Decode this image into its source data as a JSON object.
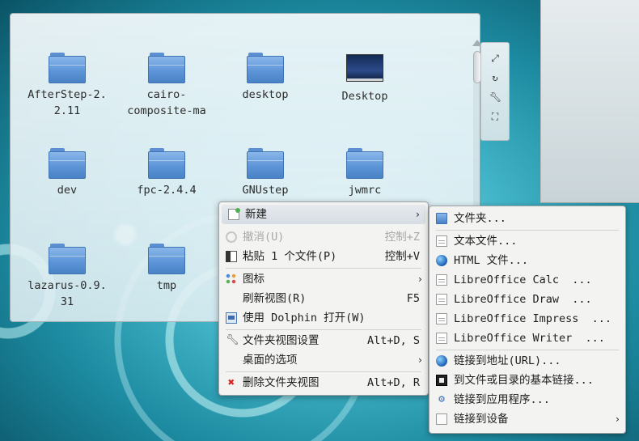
{
  "desktop_icons": [
    {
      "label": "AfterStep-2.\n2.11",
      "kind": "folder"
    },
    {
      "label": "cairo-\ncomposite-ma",
      "kind": "folder"
    },
    {
      "label": "desktop",
      "kind": "folder"
    },
    {
      "label": "Desktop",
      "kind": "screen"
    },
    {
      "label": "dev",
      "kind": "folder"
    },
    {
      "label": "fpc-2.4.4",
      "kind": "folder"
    },
    {
      "label": "GNUstep",
      "kind": "folder"
    },
    {
      "label": "jwmrc",
      "kind": "folder"
    },
    {
      "label": "lazarus-0.9.\n31",
      "kind": "folder"
    },
    {
      "label": "tmp",
      "kind": "folder"
    }
  ],
  "toolbox_icons": [
    "resize-icon",
    "rotate-icon",
    "settings-wrench-icon",
    "maximize-icon"
  ],
  "context_menu": {
    "items": [
      {
        "label": "新建",
        "icon": "new-icon",
        "submenu": true,
        "highlighted": true
      },
      {
        "label": "撤消(U)",
        "shortcut": "控制+Z",
        "icon": "undo-icon",
        "disabled": true
      },
      {
        "label": "粘贴 1 个文件(P)",
        "shortcut": "控制+V",
        "icon": "paste-icon"
      },
      {
        "label": "图标",
        "icon": "icons-grid-icon",
        "submenu": true
      },
      {
        "label": "刷新视图(R)",
        "shortcut": "F5"
      },
      {
        "label": "使用 Dolphin 打开(W)",
        "icon": "dolphin-icon"
      },
      {
        "label": "文件夹视图设置",
        "shortcut": "Alt+D, S",
        "icon": "wrench-icon"
      },
      {
        "label": "桌面的选项",
        "submenu": true
      },
      {
        "label": "删除文件夹视图",
        "shortcut": "Alt+D, R",
        "icon": "delete-icon"
      }
    ]
  },
  "new_submenu": {
    "items": [
      {
        "label": "文件夹...",
        "icon": "folder-icon"
      },
      {
        "label": "文本文件...",
        "icon": "text-file-icon"
      },
      {
        "label": "HTML 文件...",
        "icon": "html-globe-icon"
      },
      {
        "label": "LibreOffice Calc  ...",
        "icon": "calc-doc-icon"
      },
      {
        "label": "LibreOffice Draw  ...",
        "icon": "draw-doc-icon"
      },
      {
        "label": "LibreOffice Impress  ...",
        "icon": "impress-doc-icon"
      },
      {
        "label": "LibreOffice Writer  ...",
        "icon": "writer-doc-icon"
      },
      {
        "label": "链接到地址(URL)...",
        "icon": "url-globe-icon"
      },
      {
        "label": "到文件或目录的基本链接...",
        "icon": "basic-link-icon"
      },
      {
        "label": "链接到应用程序...",
        "icon": "application-gear-icon"
      },
      {
        "label": "链接到设备",
        "icon": "device-icon",
        "submenu": true
      }
    ]
  }
}
